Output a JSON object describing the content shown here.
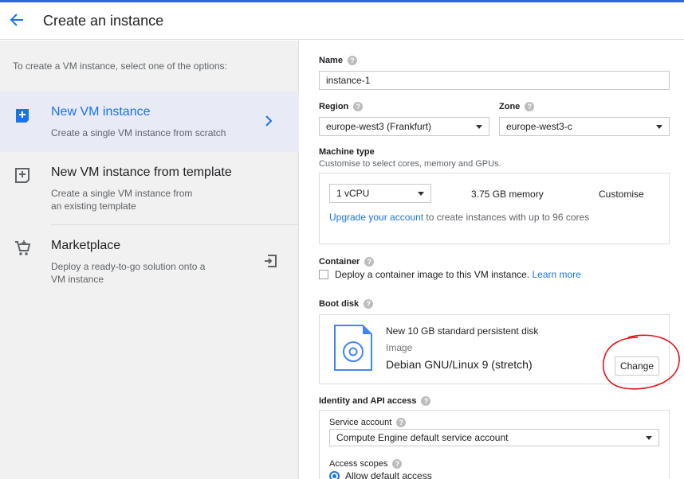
{
  "header": {
    "title": "Create an instance"
  },
  "left": {
    "intro": "To create a VM instance, select one of the options:",
    "options": [
      {
        "title": "New VM instance",
        "desc": "Create a single VM instance from scratch"
      },
      {
        "title": "New VM instance from template",
        "desc": "Create a single VM instance from an existing template"
      },
      {
        "title": "Marketplace",
        "desc": "Deploy a ready-to-go solution onto a VM instance"
      }
    ]
  },
  "form": {
    "name": {
      "label": "Name",
      "value": "instance-1"
    },
    "region": {
      "label": "Region",
      "value": "europe-west3 (Frankfurt)"
    },
    "zone": {
      "label": "Zone",
      "value": "europe-west3-c"
    },
    "machine": {
      "label": "Machine type",
      "sub": "Customise to select cores, memory and GPUs.",
      "cpu": "1 vCPU",
      "memory": "3.75 GB memory",
      "customise": "Customise",
      "upgrade_link": "Upgrade your account",
      "upgrade_rest": " to create instances with up to 96 cores"
    },
    "container": {
      "label": "Container",
      "checkbox_text": "Deploy a container image to this VM instance.",
      "learn_more": "Learn more"
    },
    "boot": {
      "label": "Boot disk",
      "disk": "New 10 GB standard persistent disk",
      "image_label": "Image",
      "image": "Debian GNU/Linux 9 (stretch)",
      "change": "Change"
    },
    "identity": {
      "label": "Identity and API access",
      "service_label": "Service account",
      "service_value": "Compute Engine default service account",
      "scopes_label": "Access scopes",
      "scope_default": "Allow default access"
    }
  },
  "help_glyph": "?",
  "colors": {
    "accent": "#1a73e8",
    "annotation": "#e0141e"
  }
}
